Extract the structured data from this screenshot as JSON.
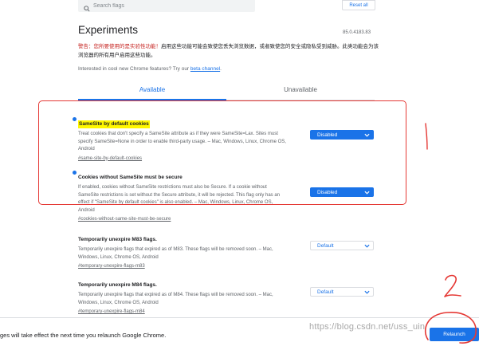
{
  "search": {
    "placeholder": "Search flags"
  },
  "header": {
    "reset_label": "Reset all",
    "title": "Experiments",
    "version": "85.0.4183.83",
    "warning_red": "警告：您所要使用的是实验性功能！",
    "warning_rest": "启用这些功能可能会致使您丢失浏览数据，或者致使您的安全或隐私受到威胁。此类功能会为该浏览器的所有用户启用这些功能。",
    "interest_text": "Interested in cool new Chrome features? Try our ",
    "interest_link": "beta channel",
    "interest_end": "."
  },
  "tabs": [
    {
      "label": "Available",
      "active": true
    },
    {
      "label": "Unavailable",
      "active": false
    }
  ],
  "flags": [
    {
      "name": "SameSite by default cookies",
      "description": "Treat cookies that don't specify a SameSite attribute as if they were SameSite=Lax. Sites must specify SameSite=None in order to enable third-party usage. – Mac, Windows, Linux, Chrome OS, Android",
      "anchor": "#same-site-by-default-cookies",
      "value": "Disabled",
      "highlighted": true,
      "modified": true
    },
    {
      "name": "Cookies without SameSite must be secure",
      "description": "If enabled, cookies without SameSite restrictions must also be Secure. If a cookie without SameSite restrictions is set without the Secure attribute, it will be rejected. This flag only has an effect if \"SameSite by default cookies\" is also enabled. – Mac, Windows, Linux, Chrome OS, Android",
      "anchor": "#cookies-without-same-site-must-be-secure",
      "value": "Disabled",
      "highlighted": false,
      "modified": true
    },
    {
      "name": "Temporarily unexpire M83 flags.",
      "description": "Temporarily unexpire flags that expired as of M83. These flags will be removed soon. – Mac, Windows, Linux, Chrome OS, Android",
      "anchor": "#temporary-unexpire-flags-m83",
      "value": "Default",
      "highlighted": false,
      "modified": false
    },
    {
      "name": "Temporarily unexpire M84 flags.",
      "description": "Temporarily unexpire flags that expired as of M84. These flags will be removed soon. – Mac, Windows, Linux, Chrome OS, Android",
      "anchor": "#temporary-unexpire-flags-m84",
      "value": "Default",
      "highlighted": false,
      "modified": false
    }
  ],
  "bottom": {
    "message": "ges will take effect the next time you relaunch Google Chrome.",
    "relaunch_label": "Relaunch"
  },
  "annotations": {
    "box_color": "#e53935",
    "mark_1": "1",
    "mark_2": "2"
  },
  "watermark": "https://blog.csdn.net/uss_uin",
  "colors": {
    "accent": "#1a73e8",
    "warning_red": "#c5221f",
    "highlight": "#fff700",
    "annotation_red": "#e53935"
  }
}
